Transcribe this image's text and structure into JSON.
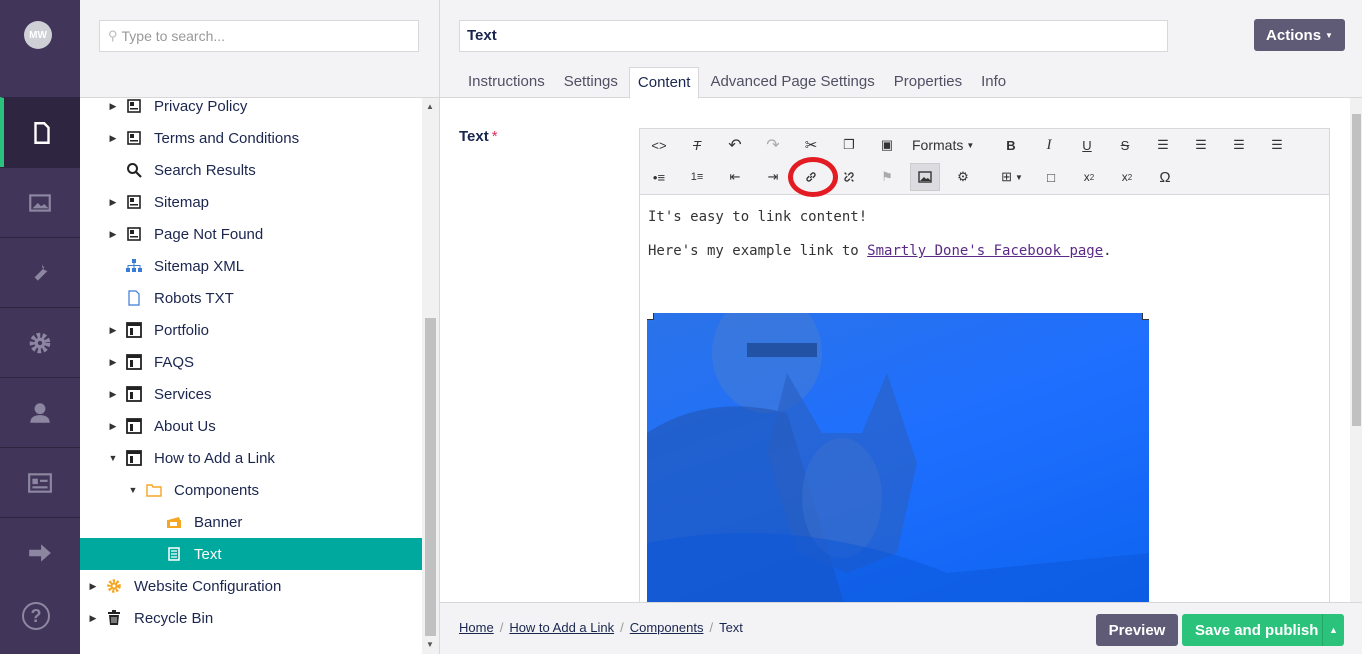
{
  "user": {
    "initials": "MW"
  },
  "sections": [
    {
      "name": "Content",
      "icon": "document-icon",
      "active": true
    },
    {
      "name": "Media",
      "icon": "image-icon"
    },
    {
      "name": "Settings",
      "icon": "wrench-icon"
    },
    {
      "name": "Packages",
      "icon": "gear-icon"
    },
    {
      "name": "Users",
      "icon": "user-icon"
    },
    {
      "name": "Members",
      "icon": "id-card-icon"
    },
    {
      "name": "Forms",
      "icon": "arrow-right-icon"
    }
  ],
  "tree": {
    "search_placeholder": "Type to search...",
    "items": [
      {
        "label": "Privacy Policy",
        "icon": "page-icon",
        "caret": "right"
      },
      {
        "label": "Terms and Conditions",
        "icon": "page-icon",
        "caret": "right"
      },
      {
        "label": "Search Results",
        "icon": "search-icon",
        "caret": ""
      },
      {
        "label": "Sitemap",
        "icon": "page-icon",
        "caret": "right"
      },
      {
        "label": "Page Not Found",
        "icon": "page-icon",
        "caret": "right"
      },
      {
        "label": "Sitemap XML",
        "icon": "sitemap-icon",
        "caret": ""
      },
      {
        "label": "Robots TXT",
        "icon": "file-icon",
        "caret": ""
      },
      {
        "label": "Portfolio",
        "icon": "layout-icon",
        "caret": "right"
      },
      {
        "label": "FAQS",
        "icon": "layout-icon",
        "caret": "right"
      },
      {
        "label": "Services",
        "icon": "layout-icon",
        "caret": "right"
      },
      {
        "label": "About Us",
        "icon": "layout-icon",
        "caret": "right"
      },
      {
        "label": "How to Add a Link",
        "icon": "layout-icon",
        "caret": "down"
      },
      {
        "label": "Components",
        "icon": "folder-icon",
        "caret": "down"
      },
      {
        "label": "Banner",
        "icon": "banner-icon",
        "caret": ""
      },
      {
        "label": "Text",
        "icon": "text-doc-icon",
        "caret": "",
        "selected": true
      },
      {
        "label": "Website Configuration",
        "icon": "cog-icon",
        "caret": "right"
      },
      {
        "label": "Recycle Bin",
        "icon": "trash-icon",
        "caret": "right"
      }
    ]
  },
  "editor": {
    "node_name": "Text",
    "actions_label": "Actions",
    "tabs": [
      "Instructions",
      "Settings",
      "Content",
      "Advanced Page Settings",
      "Properties",
      "Info"
    ],
    "active_tab": "Content",
    "field_label": "Text",
    "required_mark": "*",
    "formats_label": "Formats",
    "content": {
      "line1": "It's easy to link content!",
      "line2_prefix": "Here's my example link to ",
      "link_text": "Smartly Done's Facebook page",
      "line2_suffix": "."
    }
  },
  "footer": {
    "breadcrumbs": [
      "Home",
      "How to Add a Link",
      "Components",
      "Text"
    ],
    "preview_label": "Preview",
    "publish_label": "Save and publish"
  }
}
